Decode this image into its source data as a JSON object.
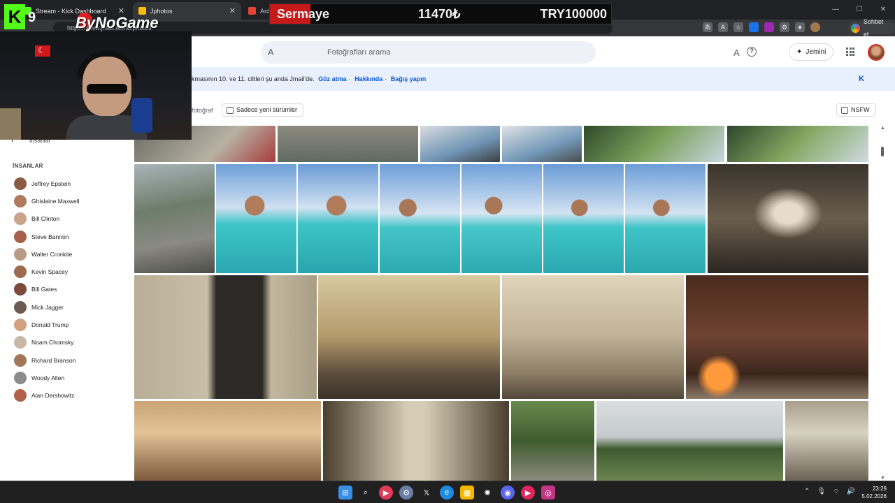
{
  "browser": {
    "tabs": [
      {
        "title": "Stream - Kick Dashboard",
        "favicon_color": "#53fc18"
      },
      {
        "title": "Jphotos",
        "favicon_color": "#fbbc05"
      },
      {
        "title": "Arda",
        "favicon_color": "#ea4335"
      }
    ],
    "address": "https://www.jmail.world/photos",
    "copilot_label": "Sohbet et",
    "toolbar_icons": [
      "translate-icon",
      "read-aloud-icon",
      "favorite-icon",
      "extension-icon",
      "extension2-icon",
      "extensions-icon",
      "favorites-icon",
      "profile-icon"
    ]
  },
  "overlay": {
    "ticker_label": "Sermaye",
    "ticker_amount": "11470₺",
    "ticker_target": "TRY100000",
    "kick_logo": "K",
    "kick_number": "9",
    "brand": "ByNoGame"
  },
  "header": {
    "search_placeholder": "Fotoğrafları arama",
    "jemini_label": "Jemini",
    "font_icon": "A",
    "help_icon": "?"
  },
  "banner": {
    "text": "kmasının 10. ve 11. ciltleri şu anda Jmail'de.",
    "link1": "Göz atma",
    "link2": "Hakkında",
    "link3": "Bağış yapın",
    "sep": "·",
    "close": "K"
  },
  "filters": {
    "count_label": "fotoğraf",
    "chip_label": "Sadece yeni sürümler",
    "nsfw_label": "NSFW"
  },
  "sidebar": {
    "faces_label": "İnsanlar",
    "faces_glyph": "I",
    "heading": "İNSANLAR",
    "people": [
      {
        "name": "Jeffrey Epstein",
        "color": "#8a5a44"
      },
      {
        "name": "Ghislaine Maxwell",
        "color": "#b07a5c"
      },
      {
        "name": "Bill Clinton",
        "color": "#c9a48c"
      },
      {
        "name": "Steve Bannon",
        "color": "#a9604a"
      },
      {
        "name": "Walter Cronkite",
        "color": "#b89a86"
      },
      {
        "name": "Kevin Spacey",
        "color": "#9c6b4f"
      },
      {
        "name": "Bill Gates",
        "color": "#7d4a3b"
      },
      {
        "name": "Mick Jagger",
        "color": "#6d5a52"
      },
      {
        "name": "Donald Trump",
        "color": "#d0a080"
      },
      {
        "name": "Noam Chomsky",
        "color": "#c8b8a8"
      },
      {
        "name": "Richard Branson",
        "color": "#a07858"
      },
      {
        "name": "Woody Allen",
        "color": "#8c8c8c"
      },
      {
        "name": "Alan Dershowitz",
        "color": "#b06048"
      }
    ]
  },
  "taskbar": {
    "time": "23:29",
    "date": "5.02.2026",
    "apps": [
      "windows-start-icon",
      "search-icon",
      "media-icon",
      "settings-icon",
      "x-icon",
      "edge-icon",
      "store-icon",
      "chatgpt-icon",
      "discord-icon",
      "youtube-icon",
      "instagram-icon"
    ]
  }
}
